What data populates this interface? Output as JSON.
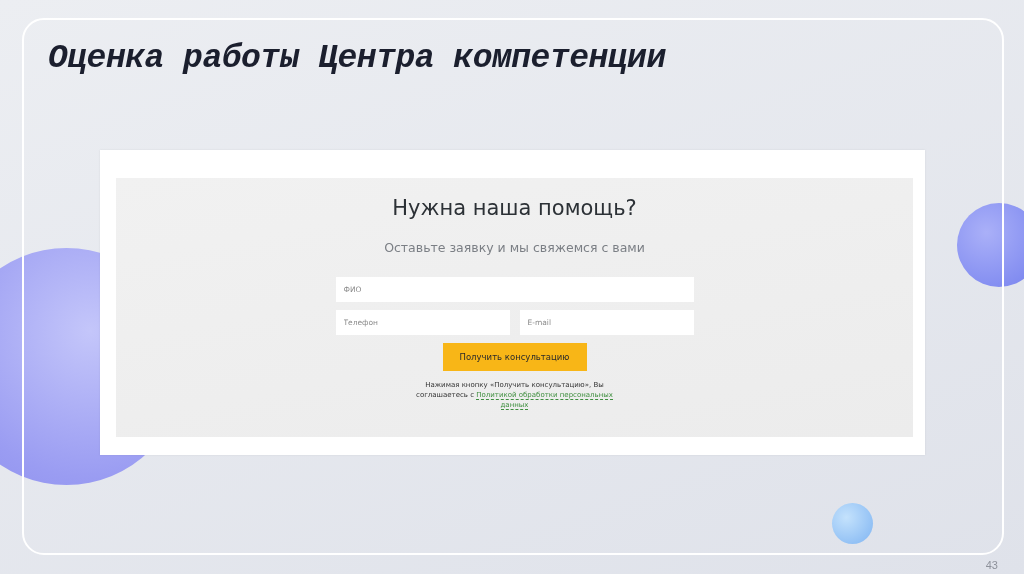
{
  "slide": {
    "title": "Оценка работы Центра компетенции",
    "page_number": "43"
  },
  "form": {
    "heading": "Нужна наша помощь?",
    "subheading": "Оставьте заявку и мы свяжемся с вами",
    "fields": [
      {
        "placeholder": "ФИО"
      },
      {
        "placeholder": "Телефон"
      },
      {
        "placeholder": "E-mail"
      }
    ],
    "button": "Получить консультацию",
    "consent": {
      "text": "Нажимая кнопку «Получить консультацию», Вы соглашаетесь с ",
      "link": "Политикой обработки персональных данных"
    }
  }
}
